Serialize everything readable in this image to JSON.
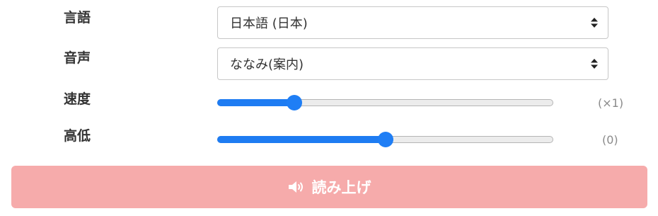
{
  "language": {
    "label": "言語",
    "selected": "日本語 (日本)"
  },
  "voice": {
    "label": "音声",
    "selected": "ななみ(案内)"
  },
  "speed": {
    "label": "速度",
    "value_text": "(×1)",
    "level": 0.23
  },
  "pitch": {
    "label": "高低",
    "value_text": "(0)",
    "level": 0.5
  },
  "read_button": {
    "label": "読み上げ",
    "icon": "speaker-icon",
    "color": "#f6abab"
  },
  "colors": {
    "accent": "#1e7cf2"
  }
}
